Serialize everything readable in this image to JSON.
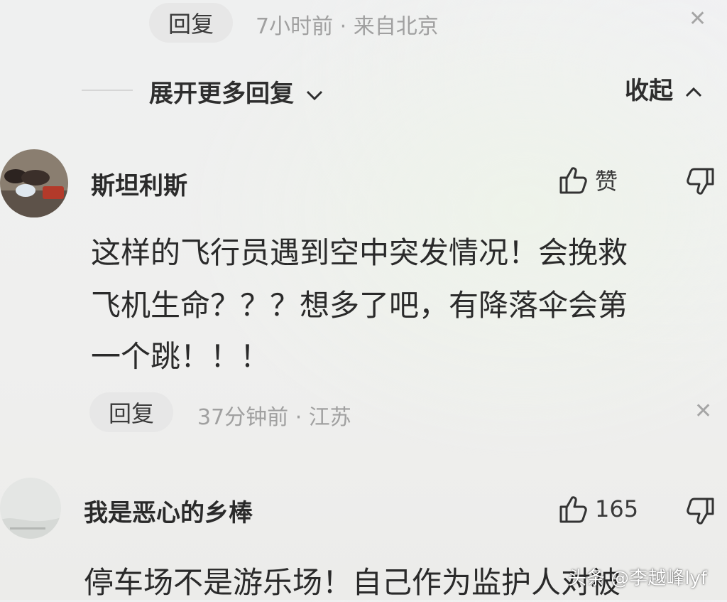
{
  "top_reply": {
    "reply_label": "回复",
    "meta": "7小时前 · 来自北京"
  },
  "thread": {
    "expand_label": "展开更多回复",
    "collapse_label": "收起"
  },
  "comments": [
    {
      "username": "斯坦利斯",
      "like_label": "赞",
      "lines": [
        "这样的飞行员遇到空中突发情况！会挽救",
        "飞机生命？？？想多了吧，有降落伞会第",
        "一个跳！！！"
      ],
      "reply_label": "回复",
      "meta": "37分钟前 · 江苏"
    },
    {
      "username": "我是恶心的乡棒",
      "like_count": "165",
      "lines": [
        "停车场不是游乐场！自己作为监护人对被"
      ]
    }
  ],
  "watermark": "头条 @李越峰lyf"
}
